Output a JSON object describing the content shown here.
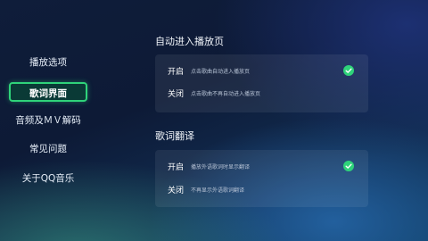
{
  "sidebar": {
    "items": [
      {
        "label": "播放选项",
        "active": false
      },
      {
        "label": "歌词界面",
        "active": true
      },
      {
        "label": "音频及ＭＶ解码",
        "active": false
      },
      {
        "label": "常见问题",
        "active": false
      },
      {
        "label": "关于QQ音乐",
        "active": false
      }
    ]
  },
  "sections": {
    "autoplay": {
      "title": "自动进入播放页",
      "options": [
        {
          "label": "开启",
          "desc": "点击歌曲自动进入播放页",
          "selected": true
        },
        {
          "label": "关闭",
          "desc": "点击歌曲不再自动进入播放页",
          "selected": false
        }
      ]
    },
    "translation": {
      "title": "歌词翻译",
      "options": [
        {
          "label": "开启",
          "desc": "播放外语歌词时显示翻译",
          "selected": true
        },
        {
          "label": "关闭",
          "desc": "不再显示外语歌词翻译",
          "selected": false
        }
      ]
    }
  },
  "colors": {
    "accent": "#2fd37a",
    "background": "#0f1d3a"
  },
  "icons": {
    "selected": "check-circle-icon"
  }
}
